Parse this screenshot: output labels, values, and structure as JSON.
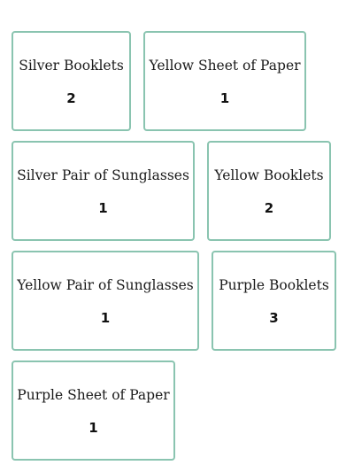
{
  "items": [
    {
      "name": "Silver Booklets",
      "count": "2"
    },
    {
      "name": "Yellow Sheet of Paper",
      "count": "1"
    },
    {
      "name": "Silver Pair of Sunglasses",
      "count": "1"
    },
    {
      "name": "Yellow Booklets",
      "count": "2"
    },
    {
      "name": "Yellow Pair of Sunglasses",
      "count": "1"
    },
    {
      "name": "Purple Booklets",
      "count": "3"
    },
    {
      "name": "Purple Sheet of Paper",
      "count": "1"
    }
  ]
}
